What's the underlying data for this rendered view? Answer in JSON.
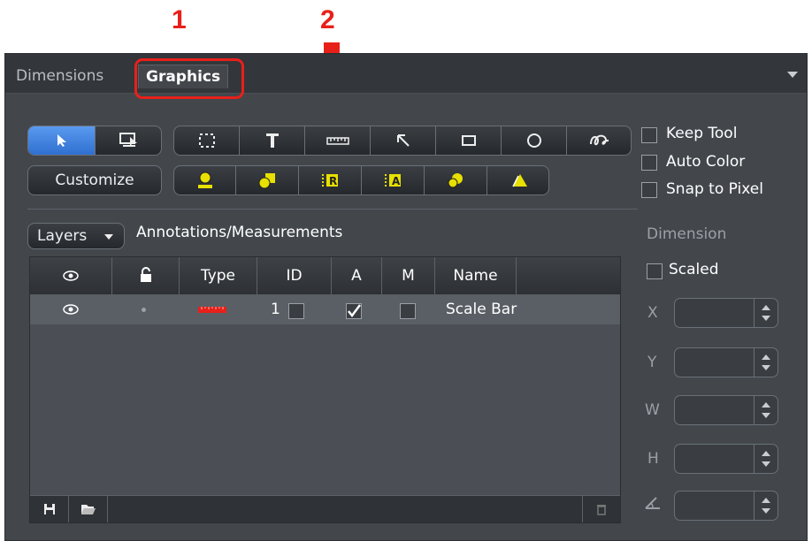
{
  "callouts": {
    "one": "1",
    "two": "2"
  },
  "tabs": [
    {
      "label": "Dimensions"
    },
    {
      "label": "Graphics"
    }
  ],
  "toolbar": {
    "customize_label": "Customize"
  },
  "options": {
    "keep_tool": "Keep Tool",
    "auto_color": "Auto Color",
    "snap_to_pixel": "Snap to Pixel"
  },
  "layers": {
    "dropdown_label": "Layers",
    "section_title": "Annotations/Measurements"
  },
  "table": {
    "headers": [
      "Type",
      "ID",
      "A",
      "M",
      "Name"
    ],
    "rows": [
      {
        "id": "1",
        "a_checked": true,
        "m_checked": false,
        "name": "Scale Bar"
      }
    ]
  },
  "dimension": {
    "title": "Dimension",
    "scaled_label": "Scaled",
    "fields": [
      "X",
      "Y",
      "W",
      "H"
    ]
  },
  "colors": {
    "accent_red": "#e8201a",
    "selected_blue": "#3a7be0",
    "tool_yellow": "#e8e000"
  }
}
